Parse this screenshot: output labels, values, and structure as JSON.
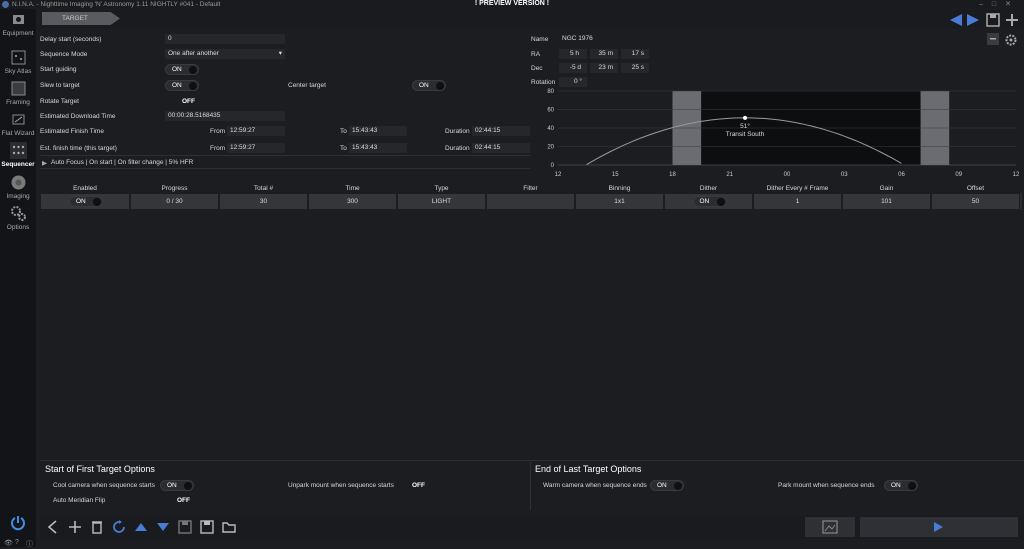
{
  "window": {
    "app_title": "N.I.N.A. - Nighttime Imaging 'N' Astronomy 1.11 NIGHTLY #041  -  Default",
    "preview_banner": "! PREVIEW VERSION !"
  },
  "sidebar": {
    "items": [
      {
        "label": "Equipment"
      },
      {
        "label": "Sky Atlas"
      },
      {
        "label": "Framing"
      },
      {
        "label": "Flat Wizard"
      },
      {
        "label": "Sequencer"
      },
      {
        "label": "Imaging"
      },
      {
        "label": "Options"
      }
    ]
  },
  "tabs": [
    {
      "label": "TARGET"
    }
  ],
  "settings": {
    "delay_start_label": "Delay start (seconds)",
    "delay_start_value": "0",
    "sequence_mode_label": "Sequence Mode",
    "sequence_mode_value": "One after another",
    "start_guiding_label": "Start guiding",
    "slew_to_target_label": "Slew to target",
    "center_target_label": "Center target",
    "rotate_target_label": "Rotate Target",
    "est_download_label": "Estimated Download Time",
    "est_download_value": "00:00:28.5168435",
    "est_finish_label": "Estimated Finish Time",
    "est_finish_this_label": "Est. finish time (this target)",
    "from_label": "From",
    "to_label": "To",
    "duration_label": "Duration",
    "est_finish_from": "12:59:27",
    "est_finish_to": "15:43:43",
    "est_finish_duration": "02:44:15",
    "est_this_from": "12:59:27",
    "est_this_to": "15:43:43",
    "est_this_duration": "02:44:15",
    "autofocus_text": "Auto Focus | On start | On filter change | 5% HFR",
    "on": "ON",
    "off": "OFF"
  },
  "target": {
    "name_label": "Name",
    "name_value": "NGC 1976",
    "ra_label": "RA",
    "ra_h": "5",
    "ra_h_unit": "h",
    "ra_m": "35",
    "ra_m_unit": "m",
    "ra_s": "17",
    "ra_s_unit": "s",
    "dec_label": "Dec",
    "dec_d": "-5",
    "dec_d_unit": "d",
    "dec_m": "23",
    "dec_m_unit": "m",
    "dec_s": "25",
    "dec_s_unit": "s",
    "rotation_label": "Rotation",
    "rotation_value": "0",
    "rotation_unit": "°"
  },
  "chart_data": {
    "type": "area",
    "x_ticks": [
      "12",
      "15",
      "18",
      "21",
      "00",
      "03",
      "06",
      "09",
      "12"
    ],
    "y_ticks": [
      "0",
      "20",
      "40",
      "60",
      "80"
    ],
    "ylim": [
      0,
      80
    ],
    "hours": [
      12,
      13.5,
      15,
      16.5,
      18,
      19.5,
      21,
      22.5,
      24,
      25.5,
      27,
      28.5
    ],
    "altitude": [
      -45,
      -30,
      -15,
      0,
      18,
      35,
      48,
      51,
      42,
      25,
      5,
      -10
    ],
    "peak_label": "51°",
    "peak_caption": "Transit South",
    "peak_x": 21.8,
    "peak_y": 51,
    "twilight_bands": [
      [
        18.0,
        19.5
      ],
      [
        31.0,
        32.5
      ]
    ],
    "night_band": [
      19.5,
      31.0
    ],
    "line_color": "#9a9a9a"
  },
  "table": {
    "headers": [
      "Enabled",
      "Progress",
      "Total #",
      "Time",
      "Type",
      "Filter",
      "Binning",
      "Dither",
      "Dither Every # Frame",
      "Gain",
      "Offset"
    ],
    "row": {
      "enabled": "ON",
      "progress": "0 / 30",
      "total": "30",
      "time": "300",
      "type": "LIGHT",
      "filter": "",
      "binning": "1x1",
      "dither": "ON",
      "dither_every": "1",
      "gain": "101",
      "offset": "50"
    }
  },
  "start_options": {
    "title": "Start of First Target Options",
    "cool_camera_label": "Cool camera when sequence starts",
    "unpark_label": "Unpark mount when sequence starts",
    "meridian_label": "Auto Meridian Flip"
  },
  "end_options": {
    "title": "End of Last Target Options",
    "warm_camera_label": "Warm camera when sequence ends",
    "park_label": "Park mount when sequence ends"
  },
  "colors": {
    "accent": "#4a7bd6",
    "background": "#1c1d21"
  }
}
